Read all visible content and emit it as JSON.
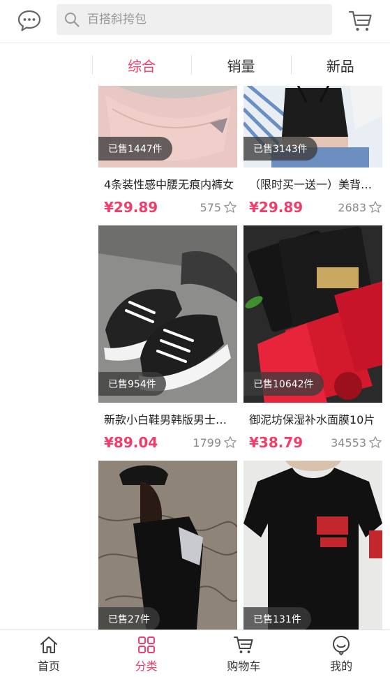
{
  "header": {
    "chat_icon": "chat-bubble-icon",
    "search_placeholder": "百搭斜挎包",
    "cart_icon": "cart-icon"
  },
  "sort_tabs": [
    {
      "label": "综合",
      "active": true
    },
    {
      "label": "销量",
      "active": false
    },
    {
      "label": "新品",
      "active": false
    }
  ],
  "products": [
    {
      "sold": "已售1447件",
      "title": "4条装性感中腰无痕内裤女",
      "price": "¥29.89",
      "likes": "575"
    },
    {
      "sold": "已售3143件",
      "title": "（限时买一送一）美背吊带",
      "price": "¥29.89",
      "likes": "2683"
    },
    {
      "sold": "已售954件",
      "title": "新款小白鞋男韩版男士帆布鞋",
      "price": "¥89.04",
      "likes": "1799"
    },
    {
      "sold": "已售10642件",
      "title": "御泥坊保湿补水面膜10片",
      "price": "¥38.79",
      "likes": "34553"
    },
    {
      "sold": "已售27件",
      "title": "",
      "price": "",
      "likes": ""
    },
    {
      "sold": "已售131件",
      "title": "",
      "price": "",
      "likes": ""
    }
  ],
  "tabbar": [
    {
      "label": "首页",
      "icon": "home-icon",
      "active": false
    },
    {
      "label": "分类",
      "icon": "grid-icon",
      "active": true
    },
    {
      "label": "购物车",
      "icon": "cart-icon",
      "active": false
    },
    {
      "label": "我的",
      "icon": "user-face-icon",
      "active": false
    }
  ],
  "colors": {
    "accent": "#f23d6b",
    "text": "#333333",
    "muted": "#8a8a8a"
  }
}
